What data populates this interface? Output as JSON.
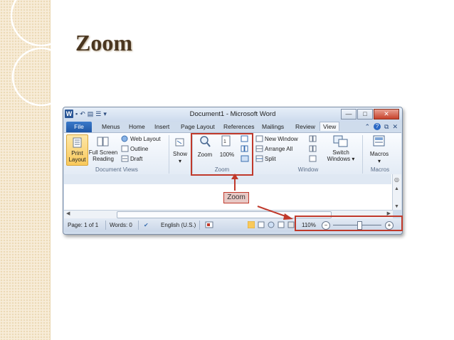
{
  "slide": {
    "title": "Zoom"
  },
  "window": {
    "title": "Document1 - Microsoft Word",
    "controls": {
      "minimize": "—",
      "maximize": "□",
      "close": "✕"
    }
  },
  "qat": {
    "logo": "W",
    "save": "💾",
    "undo": "↶",
    "extra": "▾"
  },
  "tabs": [
    "File",
    "Menus",
    "Home",
    "Insert",
    "Page Layout",
    "References",
    "Mailings",
    "Review",
    "View"
  ],
  "active_tab": "View",
  "ribbon": {
    "document_views": {
      "label": "Document Views",
      "print_layout": "Print\nLayout",
      "full_screen_reading": "Full Screen\nReading",
      "web_layout": "Web Layout",
      "outline": "Outline",
      "draft": "Draft"
    },
    "show": {
      "label": "Show",
      "arrow": "▾"
    },
    "zoom": {
      "label": "Zoom",
      "zoom": "Zoom",
      "hundred": "100%"
    },
    "window": {
      "label": "Window",
      "new_window": "New Window",
      "arrange_all": "Arrange All",
      "split": "Split",
      "switch_windows": "Switch\nWindows ▾"
    },
    "macros": {
      "label": "Macros",
      "macros": "Macros",
      "arrow": "▾"
    }
  },
  "annotation": {
    "label": "Zoom"
  },
  "status": {
    "page": "Page: 1 of 1",
    "words": "Words: 0",
    "language": "English (U.S.)",
    "zoom_percent": "110%",
    "zoom_level": 0.55,
    "minus": "−",
    "plus": "+"
  },
  "colors": {
    "highlight": "#c0392b",
    "accent": "#2b5797"
  }
}
